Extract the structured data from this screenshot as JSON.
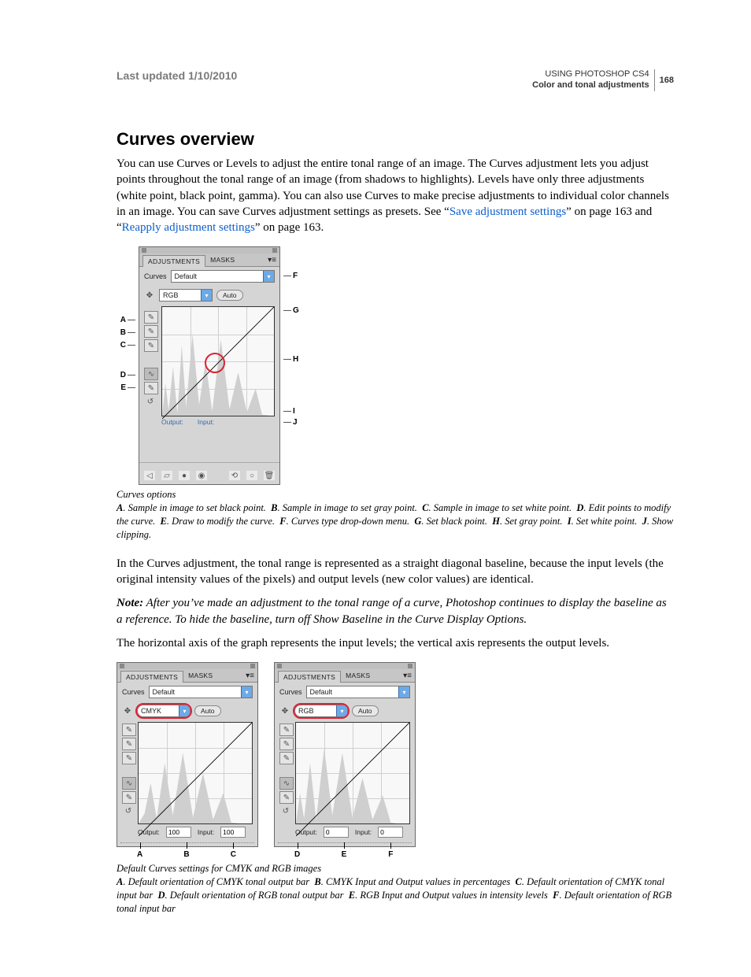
{
  "header": {
    "last_updated_label": "Last updated 1/10/2010",
    "doc_title": "USING PHOTOSHOP CS4",
    "section": "Color and tonal adjustments",
    "page_number": "168"
  },
  "heading": "Curves overview",
  "para1_a": "You can use Curves or Levels to adjust the entire tonal range of an image. The Curves adjustment lets you adjust points throughout the tonal range of an image (from shadows to highlights). Levels have only three adjustments (white point, black point, gamma). You can also use Curves to make precise adjustments to individual color channels in an image. You can save Curves adjustment settings as presets. See “",
  "link1": "Save adjustment settings",
  "para1_b": "” on page 163 and “",
  "link2": "Reapply adjustment settings",
  "para1_c": "” on page 163.",
  "panel": {
    "tab_adjustments": "ADJUSTMENTS",
    "tab_masks": "MASKS",
    "label_curves": "Curves",
    "preset_default": "Default",
    "channel_rgb": "RGB",
    "channel_cmyk": "CMYK",
    "auto": "Auto",
    "output": "Output:",
    "input": "Input:",
    "val_0": "0",
    "val_100": "100"
  },
  "callouts1": {
    "A": "A",
    "B": "B",
    "C": "C",
    "D": "D",
    "E": "E",
    "F": "F",
    "G": "G",
    "H": "H",
    "I": "I",
    "J": "J"
  },
  "fig1_caption_title": "Curves options",
  "fig1_caption": {
    "A": "Sample in image to set black point.",
    "B": "Sample in image to set gray point.",
    "C": "Sample in image to set white point.",
    "D": "Edit points to modify the curve.",
    "E": "Draw to modify the curve.",
    "F": "Curves type drop-down menu.",
    "G": "Set black point.",
    "H": "Set gray point.",
    "I": "Set white point.",
    "J": "Show clipping."
  },
  "para2": "In the Curves adjustment, the tonal range is represented as a straight diagonal baseline, because the input levels (the original intensity values of the pixels) and output levels (new color values) are identical.",
  "note_label": "Note:",
  "note_body": " After you’ve made an adjustment to the tonal range of a curve, Photoshop continues to display the baseline as a reference. To hide the baseline, turn off Show Baseline in the Curve Display Options.",
  "para3": "The horizontal axis of the graph represents the input levels; the vertical axis represents the output levels.",
  "fig2_caption_title": "Default Curves settings for CMYK and RGB images",
  "fig2_caption": {
    "A": "Default orientation of CMYK tonal output bar",
    "B": "CMYK Input and Output values in percentages",
    "C": "Default orientation of CMYK tonal input bar",
    "D": "Default orientation of RGB tonal output bar",
    "E": "RGB Input and Output values in intensity levels",
    "F": "Default orientation of RGB tonal input bar"
  },
  "ann": {
    "A": "A",
    "B": "B",
    "C": "C",
    "D": "D",
    "E": "E",
    "F": "F"
  }
}
